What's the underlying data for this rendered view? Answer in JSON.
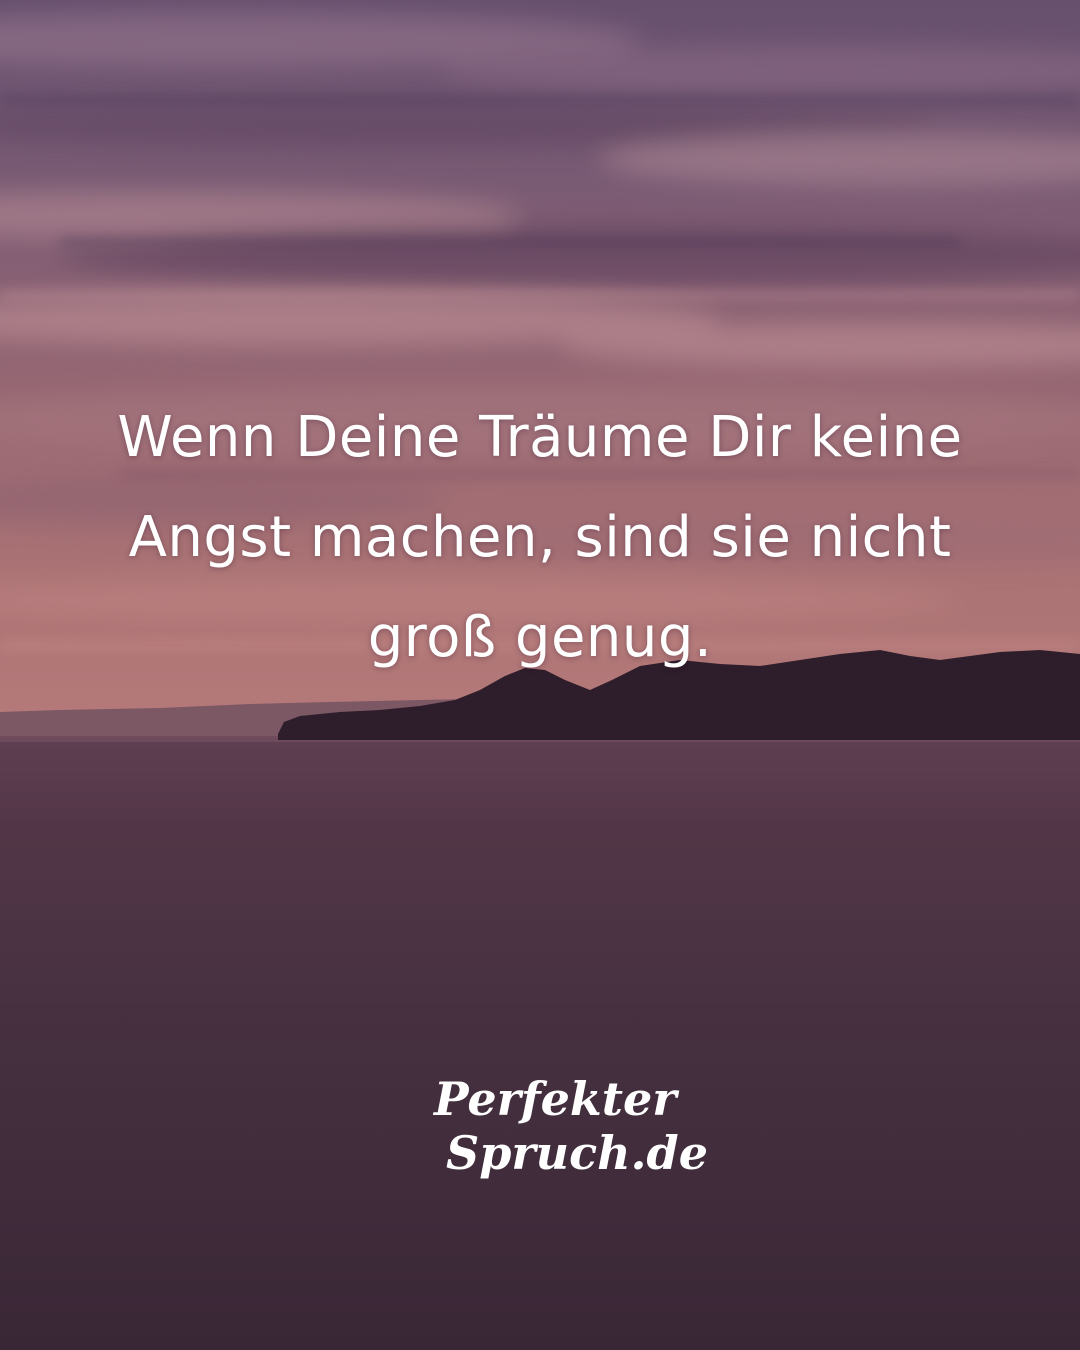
{
  "quote": {
    "lines": [
      "Wenn Deine Träume Dir keine",
      "Angst machen, sind sie nicht",
      "groß genug."
    ]
  },
  "logo": {
    "line1": "Perfekter",
    "line2": "Spruch.de"
  },
  "colors": {
    "sky_top": "#6e5674",
    "sky_mid": "#a0706f",
    "horizon": "#b47879",
    "sea": "#3e2838",
    "text": "#ffffff"
  }
}
